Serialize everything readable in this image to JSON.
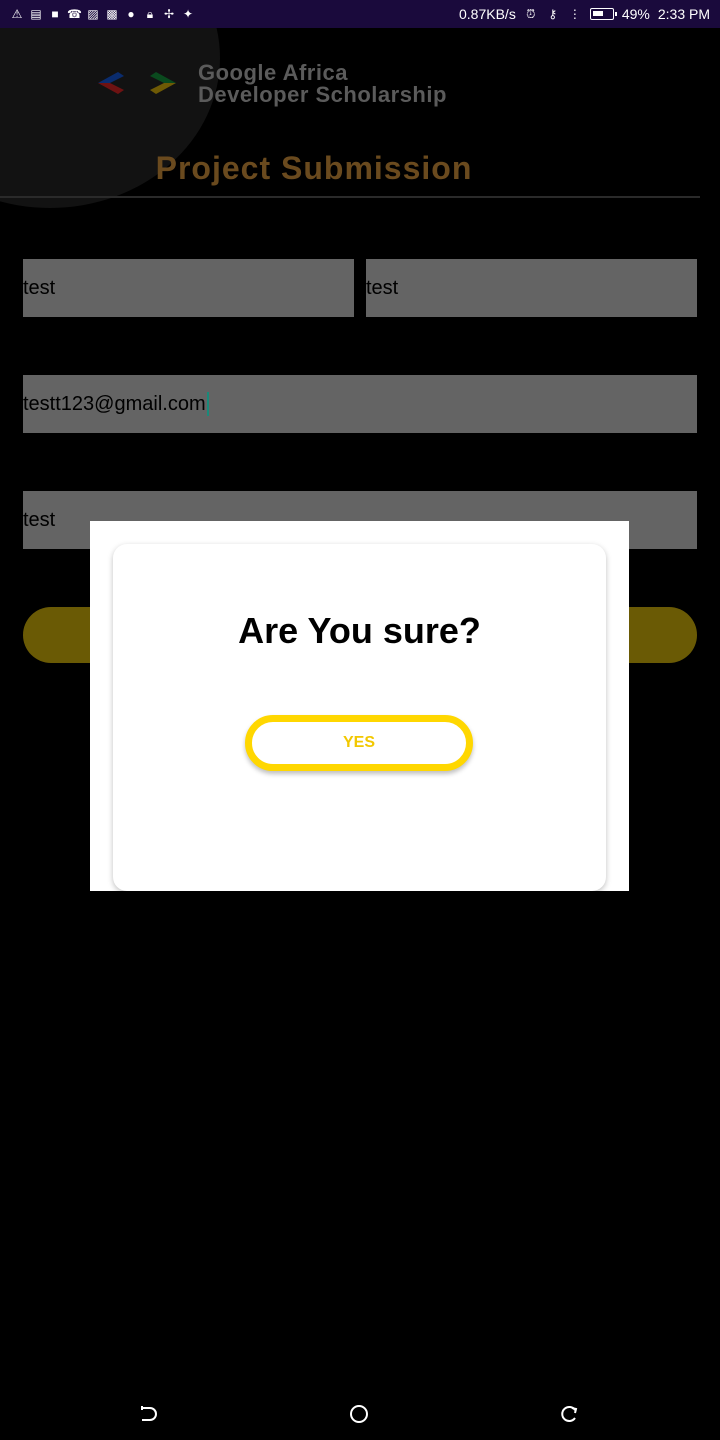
{
  "status_bar": {
    "net_speed": "0.87KB/s",
    "battery_percent": "49%",
    "time": "2:33 PM",
    "icons": [
      "warning-icon",
      "message-icon",
      "square-icon",
      "missed-call-icon",
      "image-icon",
      "photo-icon",
      "circle-icon",
      "lock-icon",
      "vpn-icon",
      "twitter-icon"
    ]
  },
  "header": {
    "brand_line1": "Google Africa",
    "brand_line2": "Developer Scholarship",
    "page_title": "Project Submission"
  },
  "form": {
    "first_name": "test",
    "last_name": "test",
    "email": "testt123@gmail.com",
    "project_link": "test"
  },
  "dialog": {
    "title": "Are You sure?",
    "yes_label": "YES"
  },
  "colors": {
    "accent_yellow": "#ffd700",
    "field_bg": "#646464",
    "status_bar_bg": "#1a0a3c",
    "title_color": "#6a4a1e"
  }
}
